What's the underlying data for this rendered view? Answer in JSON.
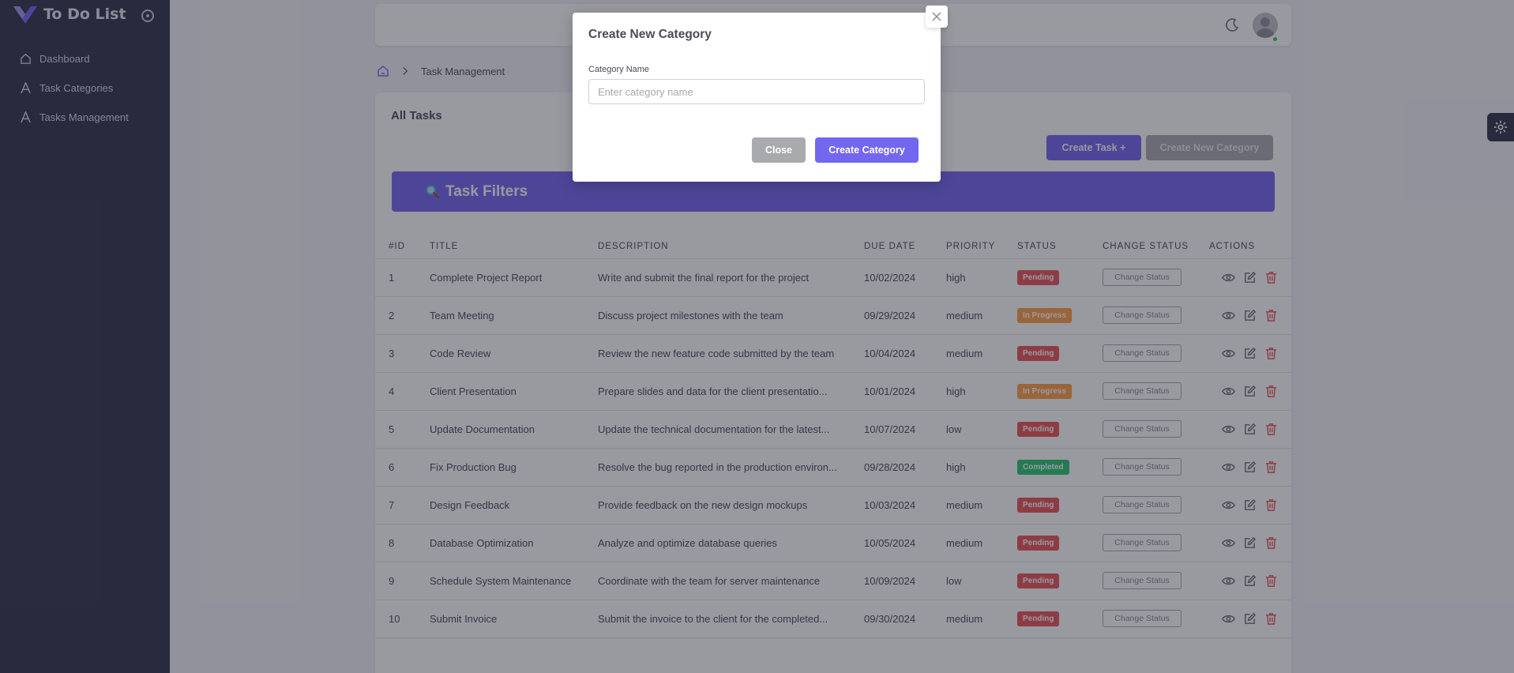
{
  "app": {
    "title": "To Do List"
  },
  "sidebar": {
    "items": [
      {
        "label": "Dashboard",
        "icon": "home-icon"
      },
      {
        "label": "Task Categories",
        "icon": "text-icon"
      },
      {
        "label": "Tasks Management",
        "icon": "text-icon"
      }
    ]
  },
  "breadcrumb": {
    "current": "Task Management"
  },
  "card": {
    "title": "All Tasks",
    "create_task_label": "Create Task",
    "new_category_label": "Create New Category",
    "filters_title": "Task Filters"
  },
  "table": {
    "headers": [
      "#ID",
      "TITLE",
      "DESCRIPTION",
      "DUE DATE",
      "PRIORITY",
      "STATUS",
      "CHANGE STATUS",
      "ACTIONS"
    ],
    "change_status_label": "Change Status",
    "rows": [
      {
        "id": "1",
        "title": "Complete Project Report",
        "description": "Write and submit the final report for the project",
        "due": "10/02/2024",
        "priority": "high",
        "status": "Pending",
        "status_color": "#ea5455"
      },
      {
        "id": "2",
        "title": "Team Meeting",
        "description": "Discuss project milestones with the team",
        "due": "09/29/2024",
        "priority": "medium",
        "status": "In Progress",
        "status_color": "#ff9f43"
      },
      {
        "id": "3",
        "title": "Code Review",
        "description": "Review the new feature code submitted by the team",
        "due": "10/04/2024",
        "priority": "medium",
        "status": "Pending",
        "status_color": "#ea5455"
      },
      {
        "id": "4",
        "title": "Client Presentation",
        "description": "Prepare slides and data for the client presentatio...",
        "due": "10/01/2024",
        "priority": "high",
        "status": "In Progress",
        "status_color": "#ff9f43"
      },
      {
        "id": "5",
        "title": "Update Documentation",
        "description": "Update the technical documentation for the latest...",
        "due": "10/07/2024",
        "priority": "low",
        "status": "Pending",
        "status_color": "#ea5455"
      },
      {
        "id": "6",
        "title": "Fix Production Bug",
        "description": "Resolve the bug reported in the production environ...",
        "due": "09/28/2024",
        "priority": "high",
        "status": "Completed",
        "status_color": "#28c76f"
      },
      {
        "id": "7",
        "title": "Design Feedback",
        "description": "Provide feedback on the new design mockups",
        "due": "10/03/2024",
        "priority": "medium",
        "status": "Pending",
        "status_color": "#ea5455"
      },
      {
        "id": "8",
        "title": "Database Optimization",
        "description": "Analyze and optimize database queries",
        "due": "10/05/2024",
        "priority": "medium",
        "status": "Pending",
        "status_color": "#ea5455"
      },
      {
        "id": "9",
        "title": "Schedule System Maintenance",
        "description": "Coordinate with the team for server maintenance",
        "due": "10/09/2024",
        "priority": "low",
        "status": "Pending",
        "status_color": "#ea5455"
      },
      {
        "id": "10",
        "title": "Submit Invoice",
        "description": "Submit the invoice to the client for the completed...",
        "due": "09/30/2024",
        "priority": "medium",
        "status": "Pending",
        "status_color": "#ea5455"
      }
    ]
  },
  "modal": {
    "title": "Create New Category",
    "field_label": "Category Name",
    "field_placeholder": "Enter category name",
    "field_value": "",
    "close_label": "Close",
    "create_label": "Create Category"
  },
  "colors": {
    "primary": "#7367f0",
    "sidebar": "#2f3349",
    "secondary": "#a8aaae"
  }
}
